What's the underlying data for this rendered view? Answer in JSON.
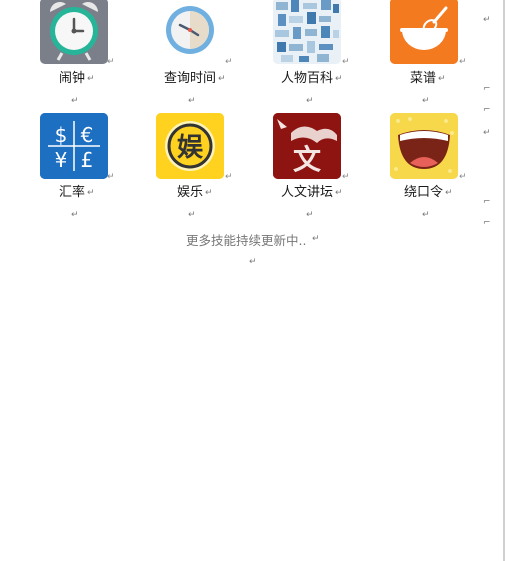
{
  "items_row1": [
    {
      "label": "闹钟",
      "icon": "alarm-clock-icon"
    },
    {
      "label": "查询时间",
      "icon": "clock-icon"
    },
    {
      "label": "人物百科",
      "icon": "encyclopedia-icon"
    },
    {
      "label": "菜谱",
      "icon": "recipe-bowl-icon"
    }
  ],
  "items_row2": [
    {
      "label": "汇率",
      "icon": "currency-exchange-icon"
    },
    {
      "label": "娱乐",
      "icon": "entertainment-icon"
    },
    {
      "label": "人文讲坛",
      "icon": "humanities-lecture-icon"
    },
    {
      "label": "绕口令",
      "icon": "tongue-twister-mouth-icon"
    }
  ],
  "currency_symbols": [
    "$",
    "€",
    "¥",
    "£"
  ],
  "entertainment_glyph": "娱",
  "humanities_glyph": "文",
  "footer": {
    "more_skills": "更多技能持续更新中.."
  },
  "marks": {
    "return": "↵",
    "left_corner": "⌐"
  },
  "colors": {
    "alarm_bg": "#7b7f89",
    "alarm_ring": "#27b59a",
    "clock_ring": "#6fb0e0",
    "recipe_bg": "#f47a1f",
    "exchange_bg": "#1d6fc1",
    "entertainment_bg": "#ffd21f",
    "humanities_bg": "#8e1411",
    "mouth_bg": "#f7d84a"
  }
}
